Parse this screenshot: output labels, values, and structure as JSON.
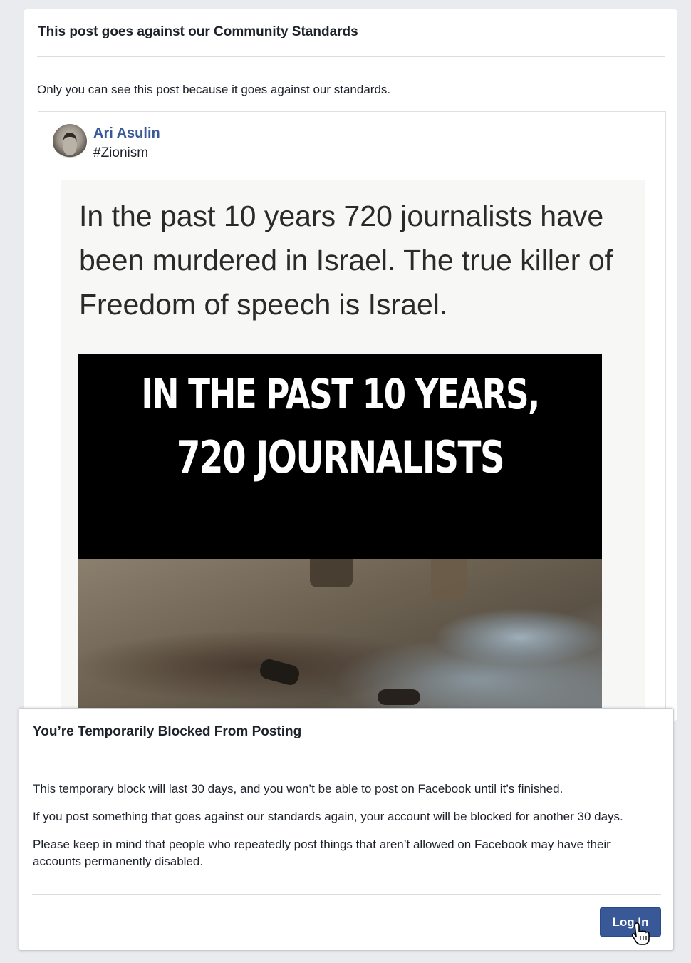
{
  "standards_dialog": {
    "title": "This post goes against our Community Standards",
    "note": "Only you can see this post because it goes against our standards."
  },
  "post": {
    "author": "Ari Asulin",
    "text": "#Zionism",
    "image": {
      "caption": "In the past 10 years 720 journalists have been murdered in Israel. The true killer of Freedom of speech is Israel.",
      "banner_line1": "IN THE PAST 10 YEARS,",
      "banner_line2": "720 JOURNALISTS"
    }
  },
  "block_dialog": {
    "title": "You’re Temporarily Blocked From Posting",
    "paragraphs": [
      "This temporary block will last 30 days, and you won’t be able to post on Facebook until it’s finished.",
      "If you post something that goes against our standards again, your account will be blocked for another 30 days.",
      "Please keep in mind that people who repeatedly post things that aren’t allowed on Facebook may have their accounts permanently disabled."
    ],
    "login_label": "Log In"
  },
  "colors": {
    "page_bg": "#e9ebee",
    "link_blue": "#385898",
    "button_blue": "#385898"
  },
  "icons": [
    "avatar",
    "hand-pointer-icon"
  ]
}
